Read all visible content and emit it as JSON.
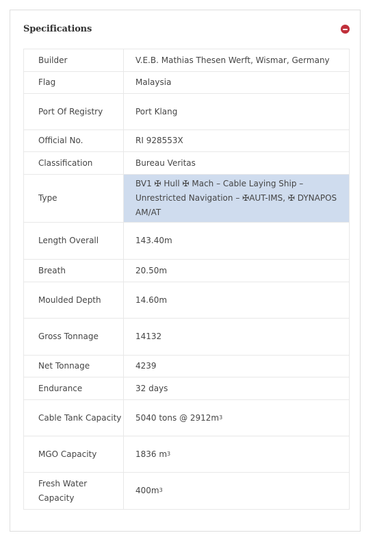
{
  "panel": {
    "title": "Specifications",
    "collapse_icon": "minus-circle-icon",
    "accent_color": "#c0303b",
    "highlight_color": "#cfdcee"
  },
  "specs": [
    {
      "label": "Builder",
      "value": "V.E.B. Mathias Thesen Werft, Wismar, Germany"
    },
    {
      "label": "Flag",
      "value": "Malaysia"
    },
    {
      "label": "Port Of Registry",
      "value": "Port Klang"
    },
    {
      "label": "Official No.",
      "value": "RI 928553X"
    },
    {
      "label": "Classification",
      "value": "Bureau Veritas"
    },
    {
      "label": "Type",
      "value": "BV1 ✠ Hull ✠ Mach – Cable Laying Ship – Unrestricted Navigation – ✠AUT-IMS, ✠ DYNAPOS AM/AT",
      "highlighted": true
    },
    {
      "label": "Length Overall",
      "value": "143.40m"
    },
    {
      "label": "Breath",
      "value": "20.50m"
    },
    {
      "label": "Moulded Depth",
      "value": "14.60m"
    },
    {
      "label": "Gross Tonnage",
      "value": "14132"
    },
    {
      "label": "Net Tonnage",
      "value": "4239"
    },
    {
      "label": "Endurance",
      "value": "32 days"
    },
    {
      "label": "Cable Tank Capacity",
      "value": "5040 tons @ 2912m",
      "sup": "3"
    },
    {
      "label": "MGO Capacity",
      "value": "1836 m",
      "sup": "3"
    },
    {
      "label": "Fresh Water Capacity",
      "value": "400m",
      "sup": "3"
    }
  ]
}
